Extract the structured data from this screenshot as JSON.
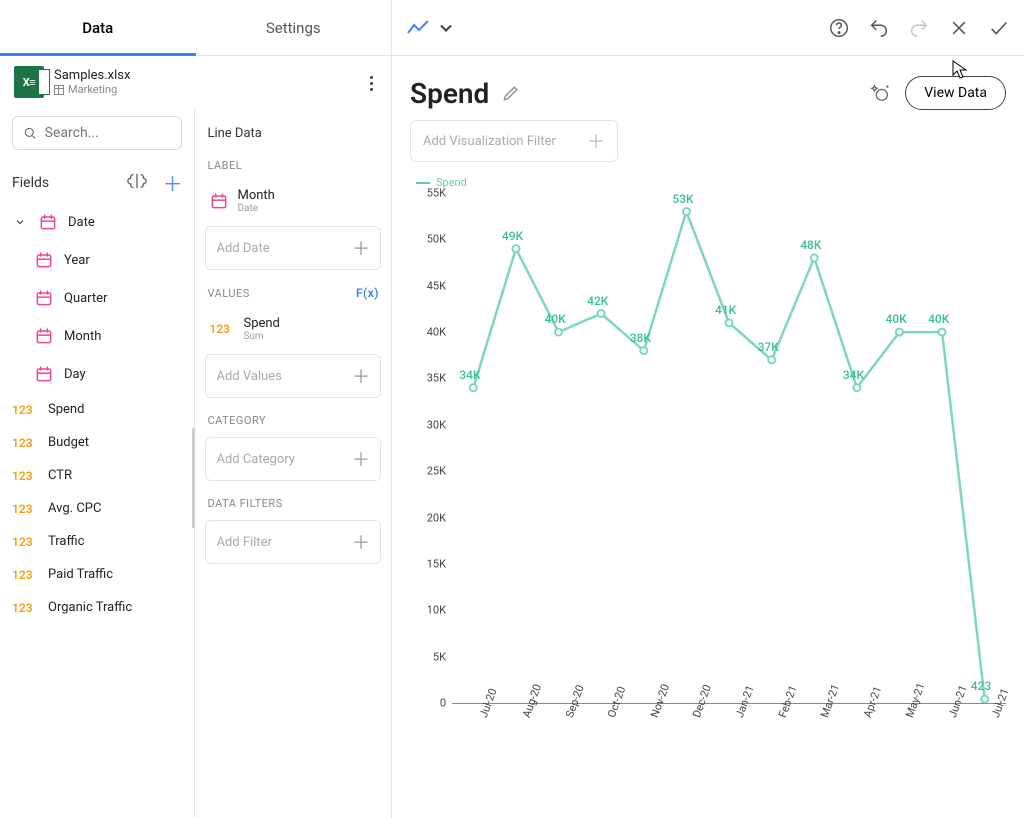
{
  "tabs": {
    "data": "Data",
    "settings": "Settings"
  },
  "datasource": {
    "file": "Samples.xlsx",
    "sheet": "Marketing",
    "xls_label": "X≡"
  },
  "search_placeholder": "Search...",
  "fields_label": "Fields",
  "fields": {
    "date_group": "Date",
    "date_children": [
      {
        "label": "Year"
      },
      {
        "label": "Quarter"
      },
      {
        "label": "Month"
      },
      {
        "label": "Day"
      }
    ],
    "measures": [
      {
        "prefix": "123",
        "label": "Spend"
      },
      {
        "prefix": "123",
        "label": "Budget"
      },
      {
        "prefix": "123",
        "label": "CTR"
      },
      {
        "prefix": "123",
        "label": "Avg. CPC"
      },
      {
        "prefix": "123",
        "label": "Traffic"
      },
      {
        "prefix": "123",
        "label": "Paid Traffic"
      },
      {
        "prefix": "123",
        "label": "Organic Traffic"
      }
    ]
  },
  "config": {
    "section": "Line Data",
    "labels_group": "LABEL",
    "values_group": "VALUES",
    "category_group": "CATEGORY",
    "filters_group": "DATA FILTERS",
    "fx": "F(x)",
    "label_chip": {
      "name": "Month",
      "sub": "Date"
    },
    "value_chip": {
      "prefix": "123",
      "name": "Spend",
      "sub": "Sum"
    },
    "add_date": "Add Date",
    "add_values": "Add Values",
    "add_category": "Add Category",
    "add_filter": "Add Filter"
  },
  "header": {
    "title": "Spend",
    "viewdata": "View Data",
    "filter_placeholder": "Add Visualization Filter"
  },
  "chart_data": {
    "type": "line",
    "legend": "Spend",
    "ylabel": "",
    "xlabel": "",
    "ylim": [
      0,
      55000
    ],
    "categories": [
      "Jul-20",
      "Aug-20",
      "Sep-20",
      "Oct-20",
      "Nov-20",
      "Dec-20",
      "Jan-21",
      "Feb-21",
      "Mar-21",
      "Apr-21",
      "May-21",
      "Jun-21",
      "Jul-21"
    ],
    "yticks": [
      "0",
      "5K",
      "10K",
      "15K",
      "20K",
      "25K",
      "30K",
      "35K",
      "40K",
      "45K",
      "50K",
      "55K"
    ],
    "series": [
      {
        "name": "Spend",
        "values": [
          34000,
          49000,
          40000,
          42000,
          38000,
          53000,
          41000,
          37000,
          48000,
          34000,
          40000,
          40000,
          423
        ],
        "labels": [
          "34K",
          "49K",
          "40K",
          "42K",
          "38K",
          "53K",
          "41K",
          "37K",
          "48K",
          "34K",
          "40K",
          "40K",
          "423"
        ]
      }
    ]
  }
}
